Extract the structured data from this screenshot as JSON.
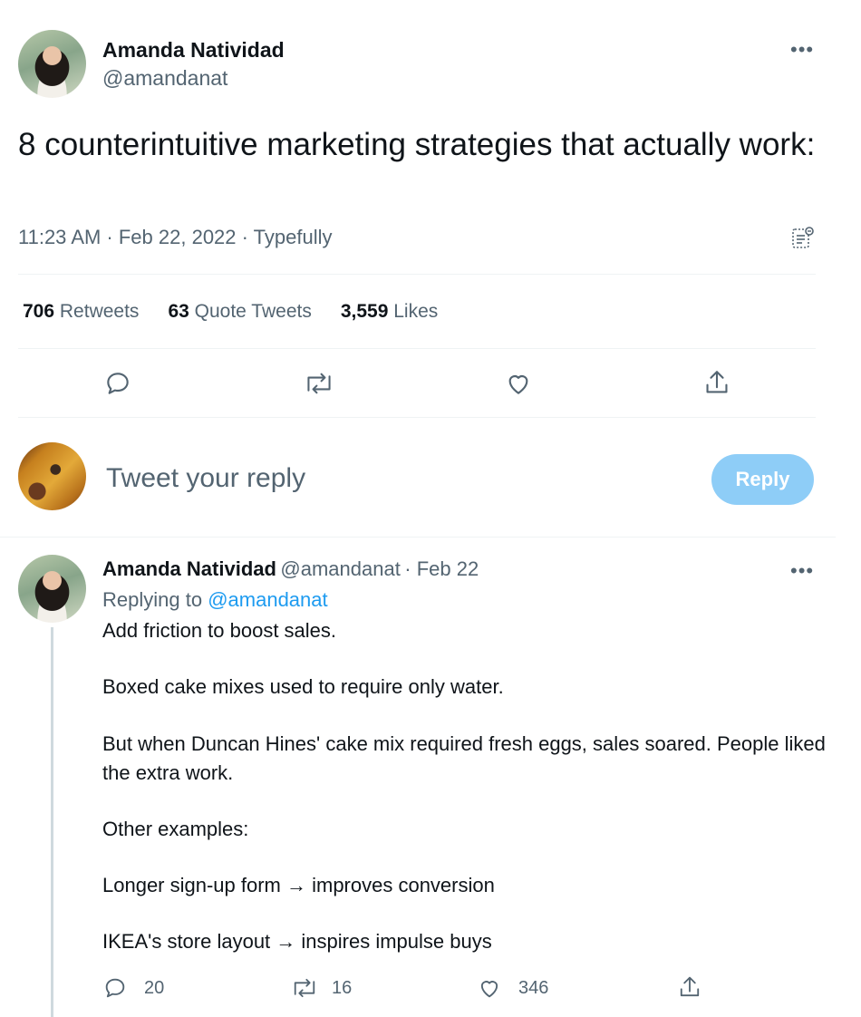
{
  "main_tweet": {
    "author_name": "Amanda Natividad",
    "author_handle": "@amandanat",
    "more_label": "•••",
    "text": "8 counterintuitive marketing strategies that actually work:",
    "time": "11:23 AM · Feb 22, 2022 · Typefully",
    "stats": {
      "retweets_count": "706",
      "retweets_label": "Retweets",
      "quotes_count": "63",
      "quotes_label": "Quote Tweets",
      "likes_count": "3,559",
      "likes_label": "Likes"
    },
    "actions": [
      "reply-icon",
      "retweet-icon",
      "like-icon",
      "share-icon"
    ]
  },
  "composer": {
    "placeholder": "Tweet your reply",
    "button_label": "Reply",
    "button_color": "#8ecdf7"
  },
  "thread_reply": {
    "author_name": "Amanda Natividad",
    "author_handle": "@amandanat",
    "date": "· Feb 22",
    "more_label": "•••",
    "replying_prefix": "Replying to",
    "replying_to": "@amandanat",
    "paragraphs": [
      "Add friction to boost sales.",
      "Boxed cake mixes used to require only water.",
      "But when Duncan Hines' cake mix required fresh eggs, sales soared. People liked the extra work.",
      "Other examples:",
      "Longer sign-up form → improves conversion",
      "IKEA's store layout → inspires impulse buys"
    ],
    "counts": {
      "replies": "20",
      "retweets": "16",
      "likes": "346"
    }
  },
  "colors": {
    "text": "#0f1419",
    "secondary": "#536471",
    "link": "#1d9bf0",
    "divider": "#eff3f4"
  }
}
